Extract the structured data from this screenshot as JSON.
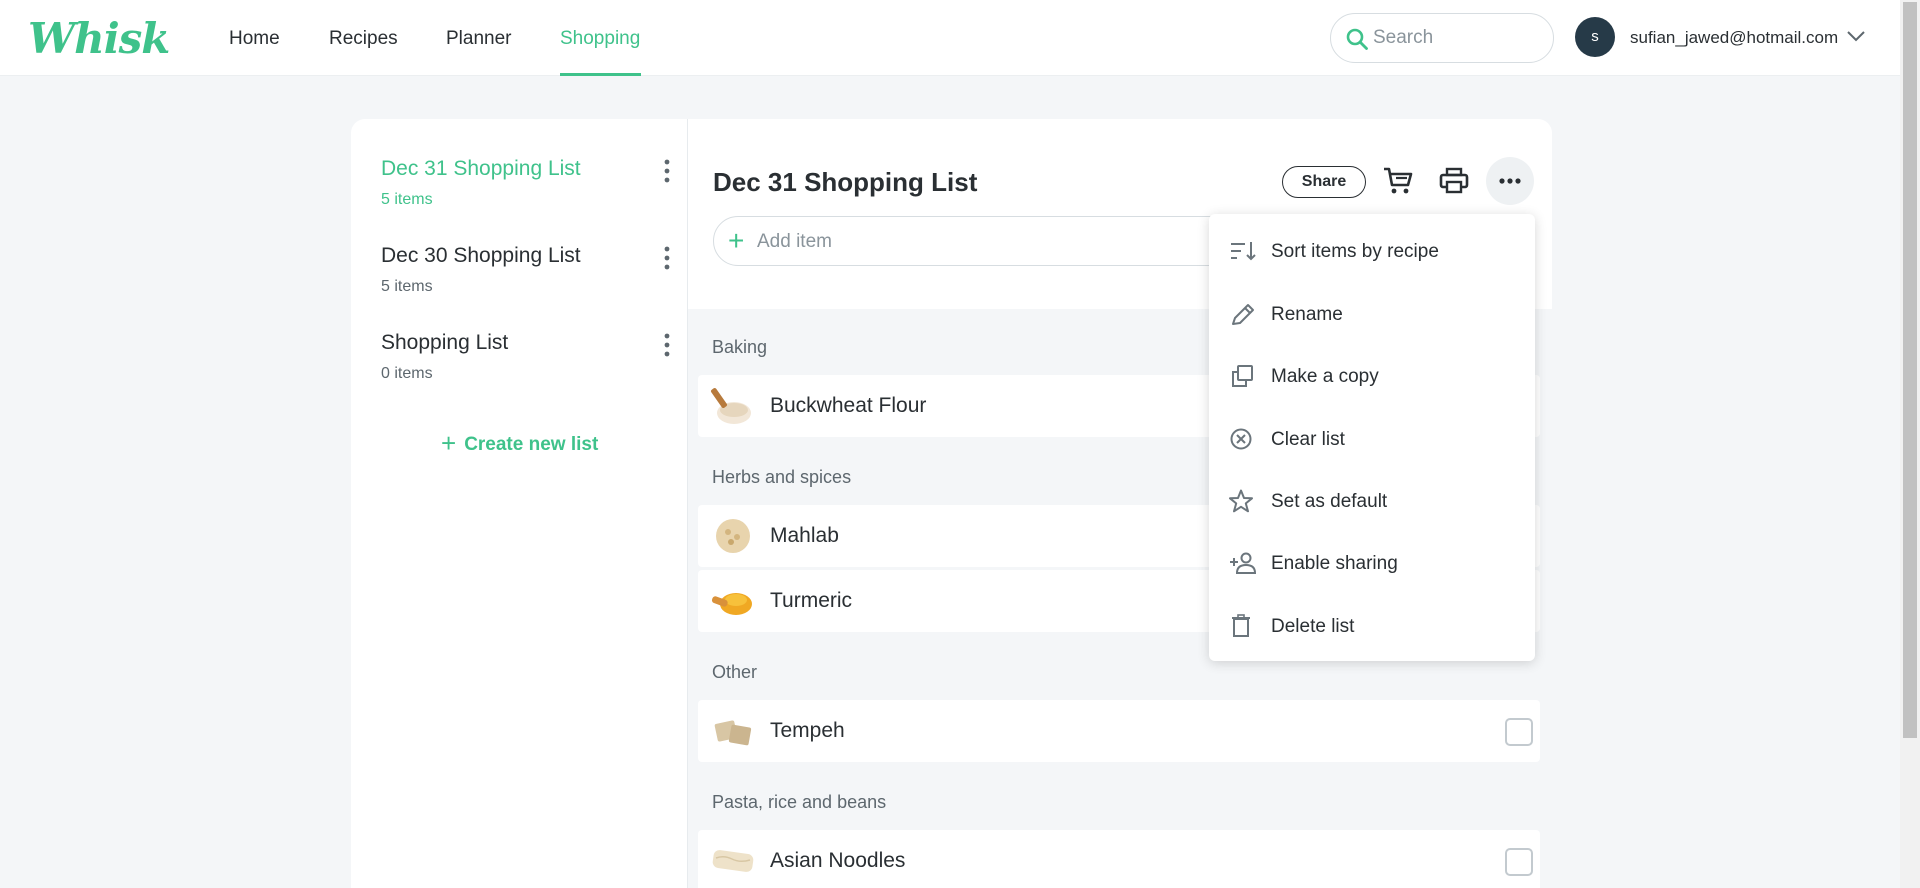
{
  "header": {
    "logo": "Whisk",
    "nav": [
      "Home",
      "Recipes",
      "Planner",
      "Shopping"
    ],
    "active_nav": "Shopping",
    "search_placeholder": "Search",
    "avatar_initial": "s",
    "user_email": "sufian_jawed@hotmail.com"
  },
  "sidebar": {
    "lists": [
      {
        "name": "Dec 31 Shopping List",
        "count": "5 items",
        "active": true
      },
      {
        "name": "Dec 30 Shopping List",
        "count": "5 items",
        "active": false
      },
      {
        "name": "Shopping List",
        "count": "0 items",
        "active": false
      }
    ],
    "create_label": "Create new list"
  },
  "main": {
    "title": "Dec 31 Shopping List",
    "share_label": "Share",
    "add_item_placeholder": "Add item",
    "categories": [
      {
        "name": "Baking",
        "items": [
          "Buckwheat Flour"
        ]
      },
      {
        "name": "Herbs and spices",
        "items": [
          "Mahlab",
          "Turmeric"
        ]
      },
      {
        "name": "Other",
        "items": [
          "Tempeh"
        ]
      },
      {
        "name": "Pasta, rice and beans",
        "items": [
          "Asian Noodles"
        ]
      }
    ]
  },
  "menu": {
    "items": [
      {
        "label": "Sort items by recipe",
        "icon": "sort-icon"
      },
      {
        "label": "Rename",
        "icon": "pencil-icon"
      },
      {
        "label": "Make a copy",
        "icon": "copy-icon"
      },
      {
        "label": "Clear list",
        "icon": "clear-icon"
      },
      {
        "label": "Set as default",
        "icon": "star-icon"
      },
      {
        "label": "Enable sharing",
        "icon": "add-person-icon"
      },
      {
        "label": "Delete list",
        "icon": "trash-icon"
      }
    ]
  },
  "colors": {
    "accent": "#3fc28b",
    "avatar": "#263a48",
    "text": "#2a2f33",
    "background": "#f4f6f8"
  }
}
